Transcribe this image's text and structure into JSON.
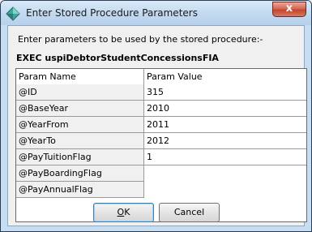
{
  "window": {
    "title": "Enter Stored Procedure Parameters",
    "close_glyph": "x"
  },
  "dialog": {
    "prompt": "Enter parameters to be used by the stored procedure:-",
    "sp_name": "EXEC uspiDebtorStudentConcessionsFIA"
  },
  "grid": {
    "headers": [
      "Param Name",
      "Param Value"
    ],
    "rows": [
      {
        "name": "@ID",
        "value": "315"
      },
      {
        "name": "@BaseYear",
        "value": "2010"
      },
      {
        "name": "@YearFrom",
        "value": "2011"
      },
      {
        "name": "@YearTo",
        "value": "2012"
      },
      {
        "name": "@PayTuitionFlag",
        "value": "1"
      },
      {
        "name": "@PayBoardingFlag",
        "value": ""
      },
      {
        "name": "@PayAnnualFlag",
        "value": ""
      }
    ]
  },
  "buttons": {
    "ok_label": "OK",
    "cancel_label": "Cancel"
  },
  "icons": {
    "app": "diamond-app-icon",
    "close": "close-icon"
  }
}
